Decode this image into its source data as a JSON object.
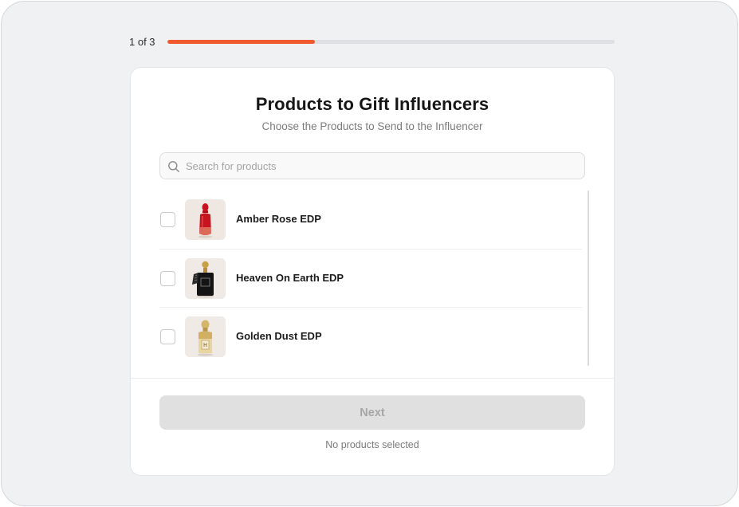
{
  "progress": {
    "label": "1 of 3",
    "percent": 33
  },
  "header": {
    "title": "Products to Gift Influencers",
    "subtitle": "Choose the Products to Send to the Influencer"
  },
  "search": {
    "placeholder": "Search for products",
    "value": "",
    "icon": "search-icon"
  },
  "products": [
    {
      "name": "Amber Rose EDP",
      "selected": false,
      "thumbnail": "red-perfume-bottle"
    },
    {
      "name": "Heaven On Earth EDP",
      "selected": false,
      "thumbnail": "black-perfume-bottle"
    },
    {
      "name": "Golden Dust EDP",
      "selected": false,
      "thumbnail": "gold-perfume-bottle"
    }
  ],
  "footer": {
    "next_label": "Next",
    "status": "No products selected"
  },
  "colors": {
    "accent": "#f1592f",
    "disabled_button": "#e0e0e1",
    "background": "#f0f1f3"
  }
}
